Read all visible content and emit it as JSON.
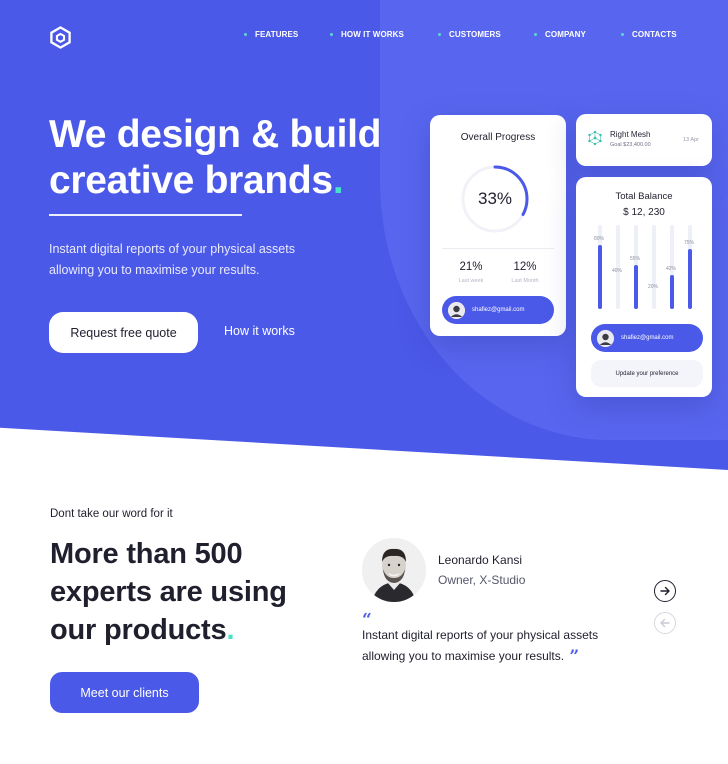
{
  "nav": {
    "items": [
      "FEATURES",
      "HOW IT WORKS",
      "CUSTOMERS",
      "COMPANY",
      "CONTACTS"
    ]
  },
  "hero": {
    "title_line1": "We design & build",
    "title_line2": "creative brands",
    "title_dot": ".",
    "subtitle_line1": "Instant digital reports of your physical assets",
    "subtitle_line2": "allowing you to maximise your results.",
    "primary_button": "Request free quote",
    "secondary_link": "How it works"
  },
  "progress_card": {
    "title": "Overall Progress",
    "percent_label": "33%",
    "percent_value": 33,
    "stats": [
      {
        "value": "21%",
        "label": "Last week"
      },
      {
        "value": "12%",
        "label": "Last Month"
      }
    ],
    "email": "shafiez@gmail.com"
  },
  "mesh_card": {
    "name": "Right Mesh",
    "goal": "Goal $23,400.00",
    "date": "13 Apr"
  },
  "balance_card": {
    "title": "Total Balance",
    "amount": "$ 12, 230",
    "bars": [
      {
        "label": "80%",
        "value": 80
      },
      {
        "label": "40%",
        "value": 40
      },
      {
        "label": "55%",
        "value": 55
      },
      {
        "label": "20%",
        "value": 20
      },
      {
        "label": "42%",
        "value": 42
      },
      {
        "label": "75%",
        "value": 75
      }
    ],
    "email": "shafiez@gmail.com",
    "preference_button": "Update your preference"
  },
  "social_proof": {
    "eyebrow": "Dont take our word for it",
    "title_line1": "More than 500",
    "title_line2": "experts are using",
    "title_line3": "our products",
    "title_dot": ".",
    "button": "Meet our clients"
  },
  "testimonial": {
    "name": "Leonardo Kansi",
    "role": "Owner, X-Studio",
    "open_quote": "“",
    "close_quote": "”",
    "quote_line1": "Instant digital reports of your physical assets",
    "quote_line2": "allowing you to maximise your results."
  },
  "colors": {
    "brand": "#4b59e8",
    "accent": "#47e0c9",
    "text": "#1f1f2e"
  }
}
